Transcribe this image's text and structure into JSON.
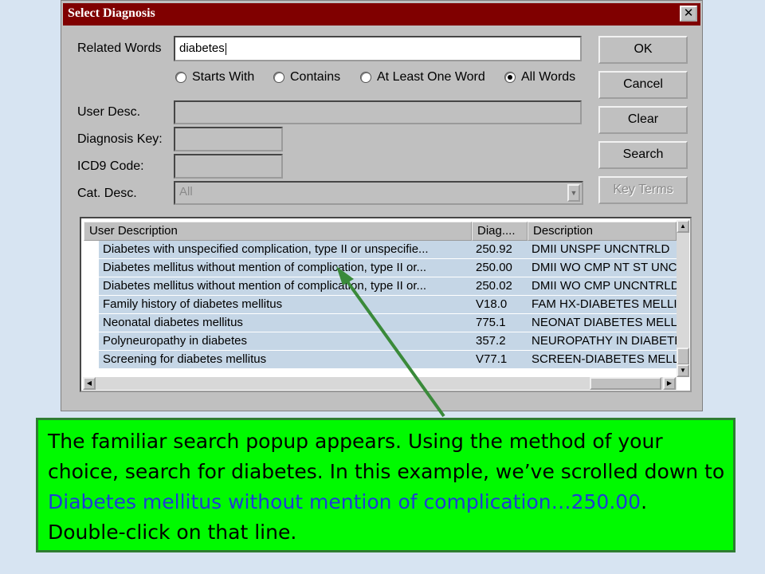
{
  "dialog": {
    "title": "Select Diagnosis",
    "close_glyph": "✕",
    "related_words": {
      "label": "Related Words",
      "value": "diabetes"
    },
    "radios": [
      {
        "label": "Starts With",
        "selected": false
      },
      {
        "label": "Contains",
        "selected": false
      },
      {
        "label": "At Least One Word",
        "selected": false
      },
      {
        "label": "All Words",
        "selected": true
      }
    ],
    "user_desc": {
      "label": "User Desc.",
      "value": ""
    },
    "diagnosis_key": {
      "label": "Diagnosis Key:",
      "value": ""
    },
    "icd9_code": {
      "label": "ICD9 Code:",
      "value": ""
    },
    "cat_desc": {
      "label": "Cat. Desc.",
      "value": "All"
    },
    "buttons": {
      "ok": "OK",
      "cancel": "Cancel",
      "clear": "Clear",
      "search": "Search",
      "key_terms": "Key Terms"
    },
    "table": {
      "columns": [
        "User Description",
        "Diag....",
        "Description"
      ],
      "rows": [
        [
          "Diabetes with unspecified complication, type II or unspecifie...",
          "250.92",
          "DMII UNSPF UNCNTRLD"
        ],
        [
          "Diabetes mellitus without mention of complication, type II or...",
          "250.00",
          "DMII WO CMP NT ST UNCNTR"
        ],
        [
          "Diabetes mellitus without mention of complication, type II or...",
          "250.02",
          "DMII WO CMP UNCNTRLD"
        ],
        [
          "Family history of diabetes mellitus",
          "V18.0",
          "FAM HX-DIABETES MELLITUS"
        ],
        [
          "Neonatal diabetes mellitus",
          "775.1",
          "NEONAT DIABETES MELLITUS"
        ],
        [
          "Polyneuropathy in diabetes",
          "357.2",
          "NEUROPATHY IN DIABETES"
        ],
        [
          "Screening for diabetes mellitus",
          "V77.1",
          "SCREEN-DIABETES MELLITUS"
        ]
      ]
    }
  },
  "callout": {
    "part1": "The familiar search popup appears.  Using the method of your choice, search for diabetes.  In this example, we’ve scrolled down to ",
    "highlight": "Diabetes mellitus without mention of complication…250.00",
    "part2": ".  Double-click on that line."
  },
  "colors": {
    "title_bar": "#800000",
    "callout_bg": "#00fa00",
    "callout_border": "#2e7d32",
    "highlight_text": "#1f3bd6",
    "arrow": "#3a8a3a",
    "row_bg": "#c5d6e6"
  }
}
